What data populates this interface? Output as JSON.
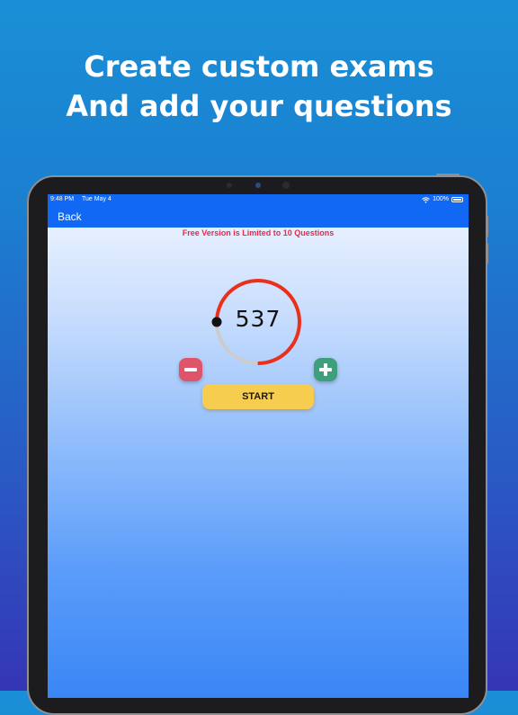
{
  "headline": {
    "line1": "Create custom exams",
    "line2": "And add your questions"
  },
  "statusbar": {
    "time": "9:48 PM",
    "date": "Tue May 4",
    "battery": "100%"
  },
  "navbar": {
    "back_label": "Back"
  },
  "notice": "Free Version is Limited to 10 Questions",
  "counter": {
    "value": "537",
    "progress_fraction": 0.75
  },
  "controls": {
    "minus_icon": "minus-icon",
    "plus_icon": "plus-icon",
    "start_label": "START"
  },
  "colors": {
    "background_top": "#1a8fd6",
    "background_bottom": "#3535b6",
    "navbar": "#1068f4",
    "dial_progress": "#ea2f1d",
    "dial_track": "#cccccc",
    "minus_button": "#e0546a",
    "plus_button": "#3ea07a",
    "start_button": "#f6cd4f",
    "notice": "#e8294a"
  }
}
